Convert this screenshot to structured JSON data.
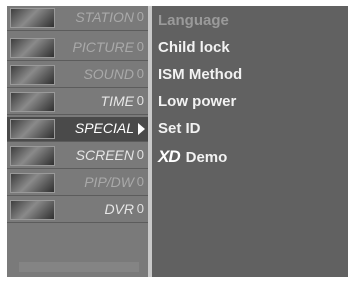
{
  "left_menu": {
    "items": [
      {
        "label": "STATION",
        "marker": "0",
        "icon": "station-thumbnail"
      },
      {
        "label": "PICTURE",
        "marker": "0",
        "icon": "picture-thumbnail"
      },
      {
        "label": "SOUND",
        "marker": "0",
        "icon": "sound-thumbnail"
      },
      {
        "label": "TIME",
        "marker": "0",
        "icon": "time-thumbnail"
      },
      {
        "label": "SPECIAL",
        "marker": "",
        "icon": "special-thumbnail"
      },
      {
        "label": "SCREEN",
        "marker": "0",
        "icon": "screen-thumbnail"
      },
      {
        "label": "PIP/DW",
        "marker": "0",
        "icon": "pip-thumbnail"
      },
      {
        "label": "DVR",
        "marker": "0",
        "icon": "dvr-thumbnail"
      }
    ],
    "selected_index": 4
  },
  "submenu": {
    "items": [
      {
        "label": "Language"
      },
      {
        "label": "Child lock"
      },
      {
        "label": "ISM Method"
      },
      {
        "label": "Low power"
      },
      {
        "label": "Set ID"
      },
      {
        "label": "Demo",
        "logo": "XD"
      }
    ]
  },
  "colors": {
    "selected_highlight": "#4a4a4a",
    "panel": "#616161",
    "divider": "#c9c9c9"
  }
}
